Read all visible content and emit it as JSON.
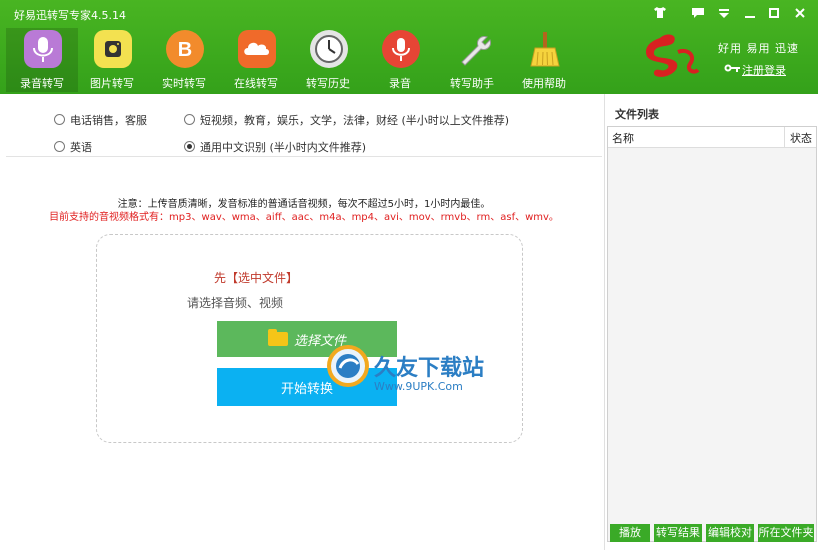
{
  "window": {
    "title": "好易迅转写专家4.5.14",
    "controls": [
      "shirt-icon",
      "message-icon",
      "dropdown-icon",
      "minimize-icon",
      "maximize-icon",
      "close-icon"
    ]
  },
  "nav": [
    {
      "label": "录音转写",
      "icon": "microphone-icon",
      "color": "#b97ad6",
      "active": true
    },
    {
      "label": "图片转写",
      "icon": "camera-icon",
      "color": "#f3e150"
    },
    {
      "label": "实时转写",
      "icon": "b-icon",
      "color": "#f28b2c"
    },
    {
      "label": "在线转写",
      "icon": "cloud-icon",
      "color": "#f06a2a"
    },
    {
      "label": "转写历史",
      "icon": "clock-icon",
      "color": "#e5e5e5"
    },
    {
      "label": "录音",
      "icon": "mic-icon",
      "color": "#e64535"
    },
    {
      "label": "转写助手",
      "icon": "wrench-icon",
      "color": "#d9d9d9"
    },
    {
      "label": "使用帮助",
      "icon": "broom-icon",
      "color": "#f5d33d"
    }
  ],
  "brand": {
    "slogan": "好用 易用 迅速",
    "register": "注册登录",
    "logo_color": "#d82121"
  },
  "options": {
    "radio1": "电话销售，客服",
    "radio2": "短视频，教育，娱乐，文学，法律，财经 (半小时以上文件推荐)",
    "radio3": "英语",
    "radio4": "通用中文识别 (半小时内文件推荐)",
    "selected": "radio4"
  },
  "notice": {
    "line1": "注意：上传音质清晰，发音标准的普通话音视频，每次不超过5小时，1小时内最佳。",
    "line2": "目前支持的音视频格式有：mp3、wav、wma、aiff、aac、m4a、mp4、avi、mov、rmvb、rm、asf、wmv。"
  },
  "drop": {
    "prompt1": "先【选中文件】",
    "prompt2": "请选择音频、视频",
    "select_label": "选择文件",
    "start_label": "开始转换"
  },
  "watermark": {
    "title": "久友下载站",
    "url": "Www.9UPK.Com"
  },
  "file_list": {
    "title": "文件列表",
    "col_name": "名称",
    "col_status": "状态"
  },
  "bottom_buttons": [
    "播放",
    "转写结果",
    "编辑校对",
    "所在文件夹"
  ]
}
